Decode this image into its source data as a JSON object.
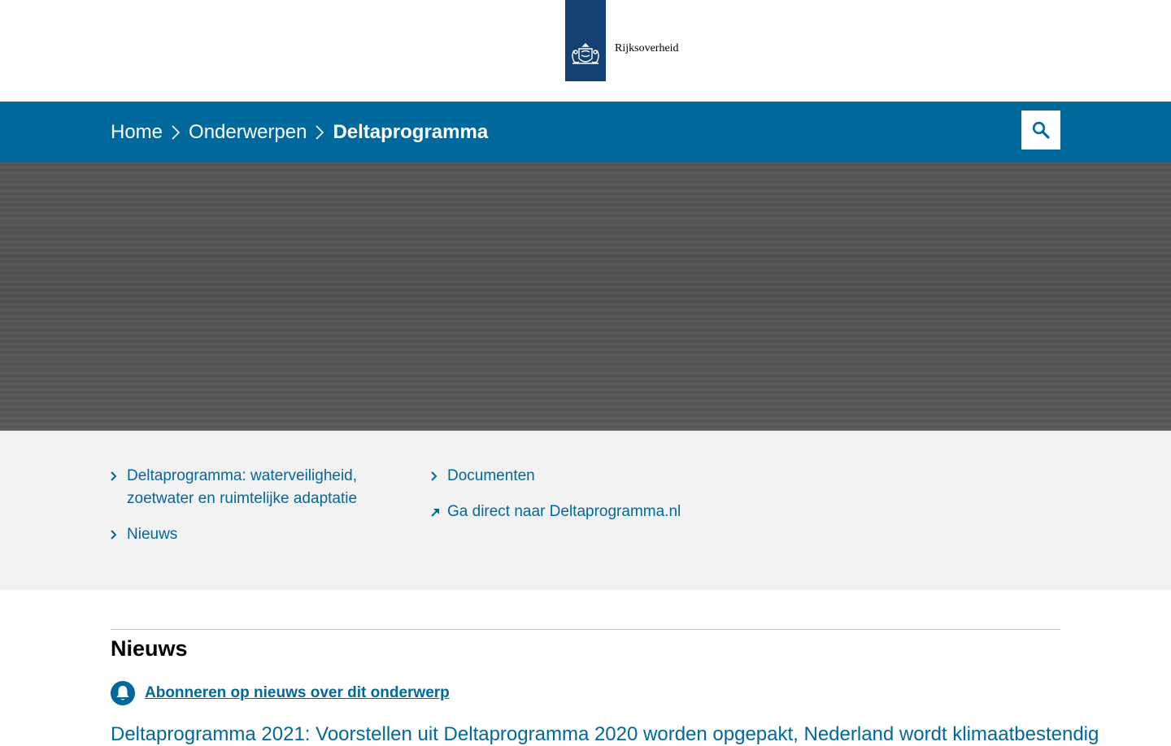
{
  "header": {
    "brand": "Rijksoverheid"
  },
  "breadcrumb": {
    "items": [
      {
        "label": "Home",
        "icon": "chevron-right-icon"
      },
      {
        "label": "Onderwerpen",
        "icon": "chevron-right-icon"
      },
      {
        "label": "Deltaprogramma"
      }
    ]
  },
  "search": {
    "icon": "search-icon"
  },
  "quicklinks": {
    "col1": [
      {
        "label": "Deltaprogramma: waterveiligheid, zoetwater en ruimtelijke adaptatie",
        "icon": "chevron-right-icon"
      },
      {
        "label": "Nieuws",
        "icon": "chevron-right-icon"
      }
    ],
    "col2": [
      {
        "label": "Documenten",
        "icon": "chevron-right-icon"
      },
      {
        "label": "Ga direct naar Deltaprogramma.nl",
        "icon": "external-arrow-icon"
      }
    ]
  },
  "news": {
    "title": "Nieuws",
    "subscribe_label": "Abonneren op nieuws over dit onderwerp",
    "subscribe_icon": "bell-icon",
    "first_item": "Deltaprogramma 2021: Voorstellen uit Deltaprogramma 2020 worden opgepakt, Nederland wordt klimaatbestendig"
  },
  "colors": {
    "brand_blue": "#154273",
    "nav_blue": "#01689b",
    "hero_gray": "#545454",
    "panel_gray": "#f2f2f2"
  }
}
